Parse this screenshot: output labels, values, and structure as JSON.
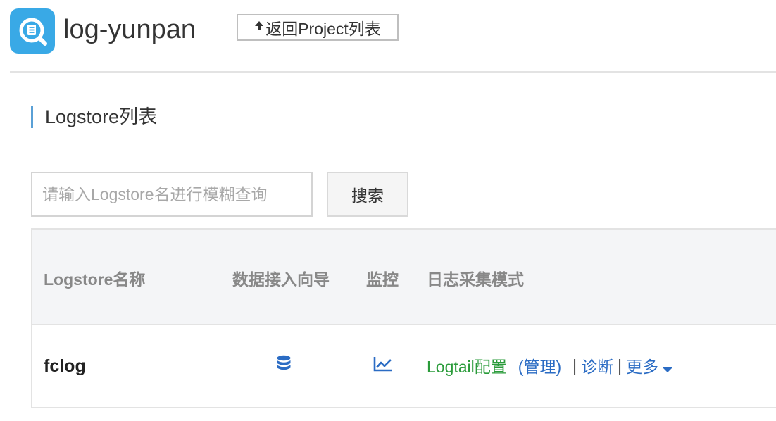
{
  "header": {
    "logo_icon": "log-service-icon",
    "project_name": "log-yunpan",
    "back_button_label": "返回Project列表",
    "back_icon": "up-arrow-icon"
  },
  "section": {
    "title": "Logstore列表"
  },
  "search": {
    "placeholder": "请输入Logstore名进行模糊查询",
    "value": "",
    "button_label": "搜索"
  },
  "table": {
    "columns": [
      "Logstore名称",
      "数据接入向导",
      "监控",
      "日志采集模式"
    ],
    "rows": [
      {
        "name": "fclog",
        "wizard_icon": "database-icon",
        "monitor_icon": "line-chart-icon",
        "logtail_config": "Logtail配置",
        "manage": "(管理)",
        "diagnose": "诊断",
        "more": "更多"
      }
    ]
  },
  "colors": {
    "accent": "#39a9e6",
    "link_blue": "#2b6cc4",
    "link_green": "#2a9b3a",
    "header_bg": "#f4f5f7"
  }
}
